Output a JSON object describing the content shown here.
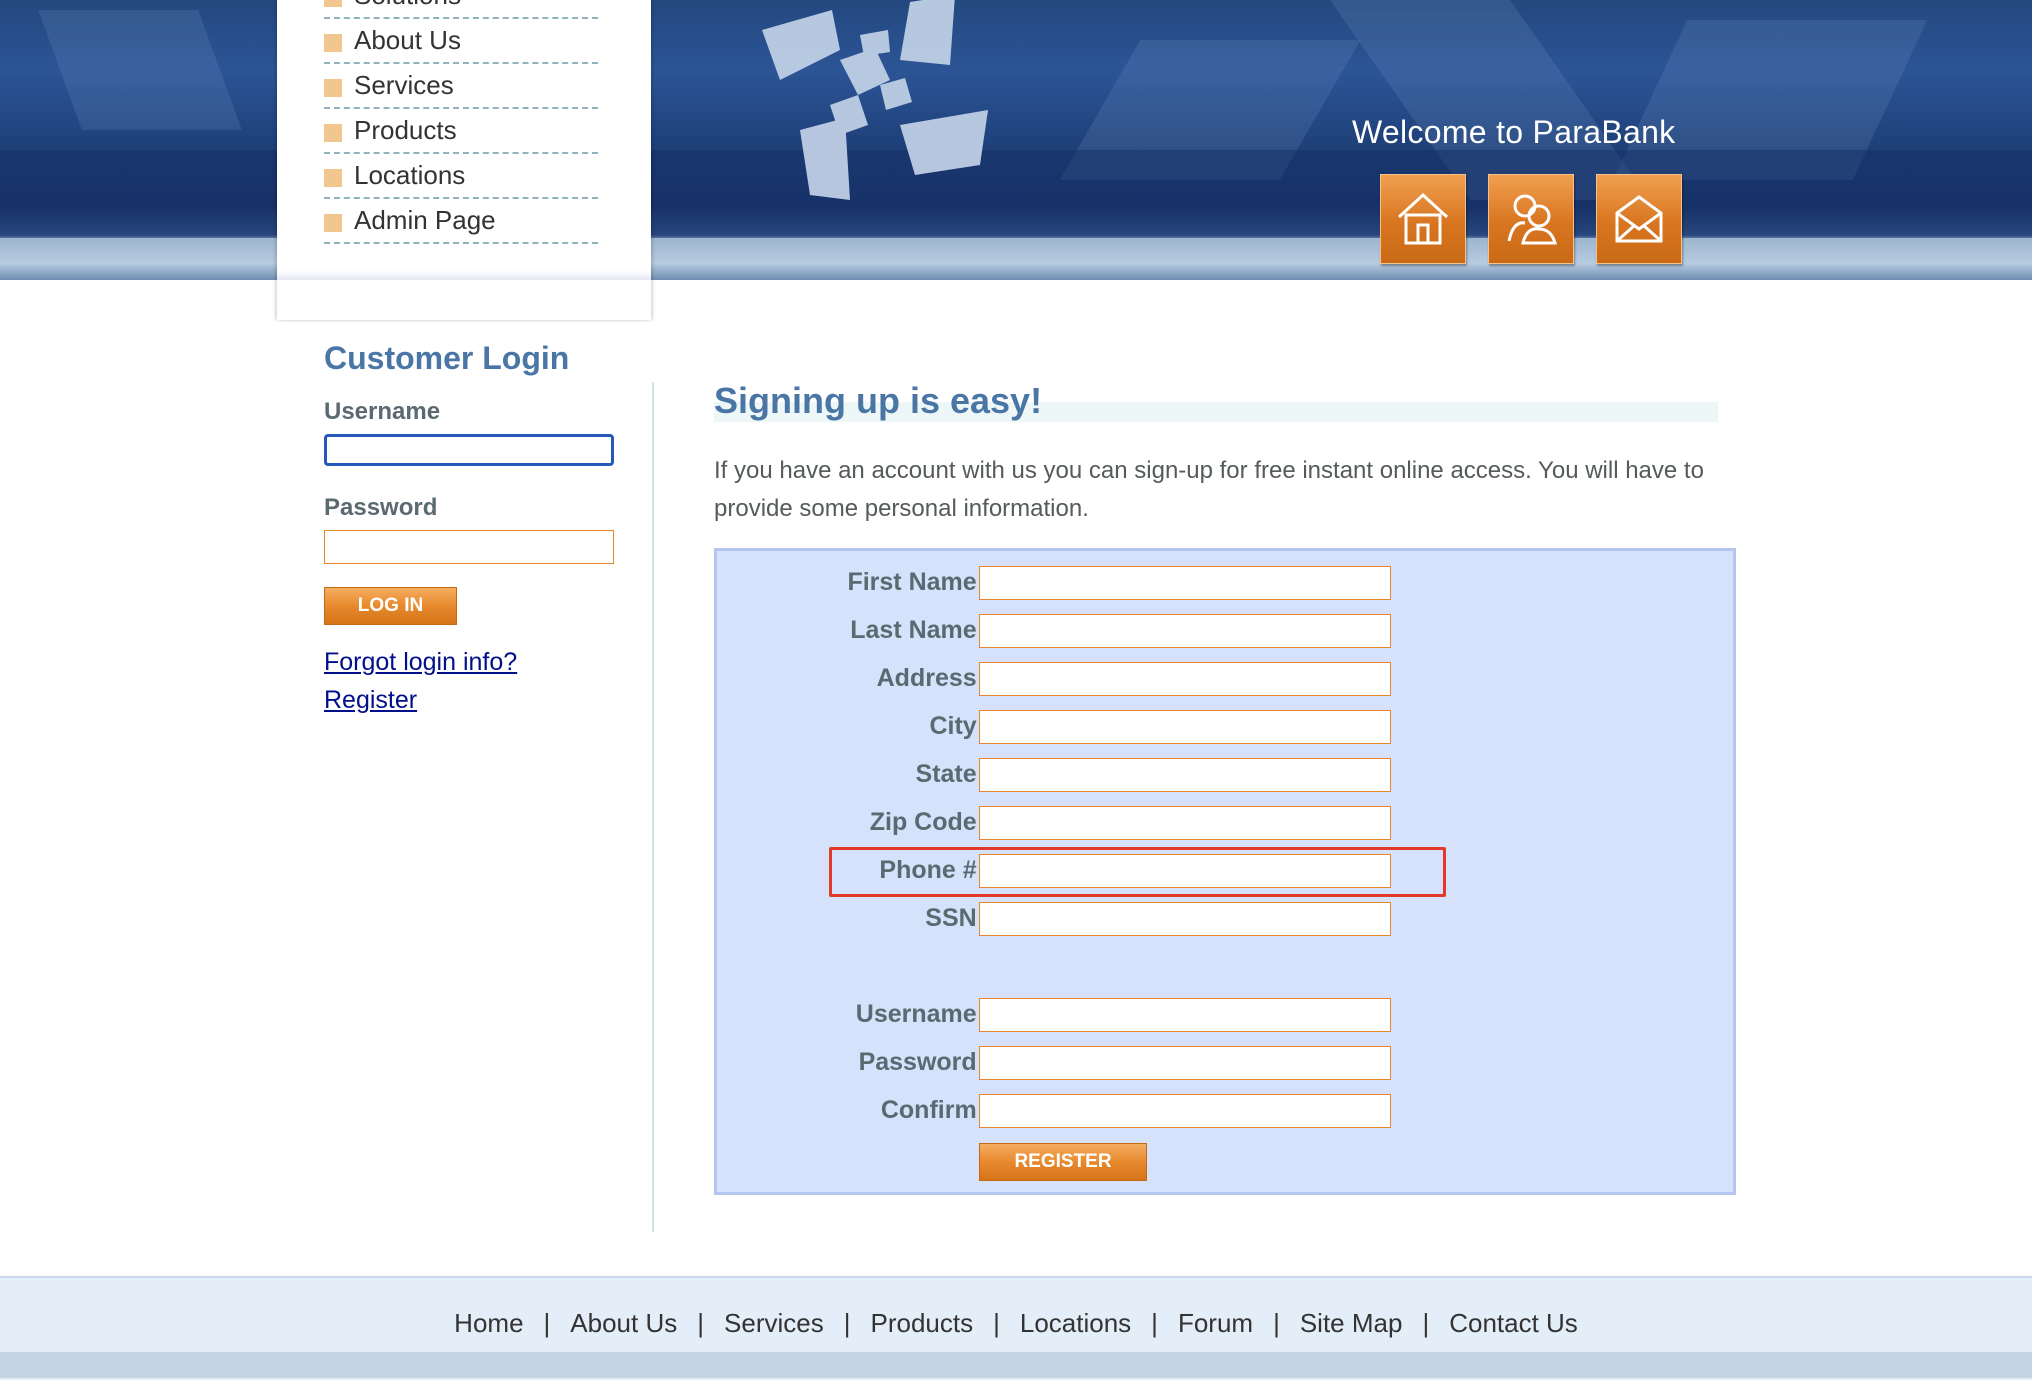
{
  "header": {
    "welcome": "Welcome to ParaBank",
    "buttons": [
      {
        "name": "home-icon"
      },
      {
        "name": "about-icon"
      },
      {
        "name": "contact-icon"
      }
    ]
  },
  "menu": {
    "items": [
      {
        "label": "Solutions"
      },
      {
        "label": "About Us"
      },
      {
        "label": "Services"
      },
      {
        "label": "Products"
      },
      {
        "label": "Locations"
      },
      {
        "label": "Admin Page"
      }
    ]
  },
  "login": {
    "title": "Customer Login",
    "username_label": "Username",
    "password_label": "Password",
    "login_button": "LOG IN",
    "forgot_link": "Forgot login info?",
    "register_link": "Register"
  },
  "main": {
    "title": "Signing up is easy!",
    "intro": "If you have an account with us you can sign-up for free instant online access. You will have to provide some personal information.",
    "fields": [
      {
        "label": "First Name:"
      },
      {
        "label": "Last Name:"
      },
      {
        "label": "Address:"
      },
      {
        "label": "City:"
      },
      {
        "label": "State:"
      },
      {
        "label": "Zip Code:"
      },
      {
        "label": "Phone #:"
      },
      {
        "label": "SSN:"
      },
      {
        "label": "Username:"
      },
      {
        "label": "Password:"
      },
      {
        "label": "Confirm:"
      }
    ],
    "register_button": "REGISTER"
  },
  "footer": {
    "links": [
      "Home",
      "About Us",
      "Services",
      "Products",
      "Locations",
      "Forum",
      "Site Map",
      "Contact Us"
    ],
    "separator": "|"
  },
  "colors": {
    "header_blue": "#24487f",
    "title_blue": "#4a76a6",
    "accent_orange": "#e8892d",
    "form_background": "#d6e2fb",
    "highlight_red": "#e2392c"
  }
}
